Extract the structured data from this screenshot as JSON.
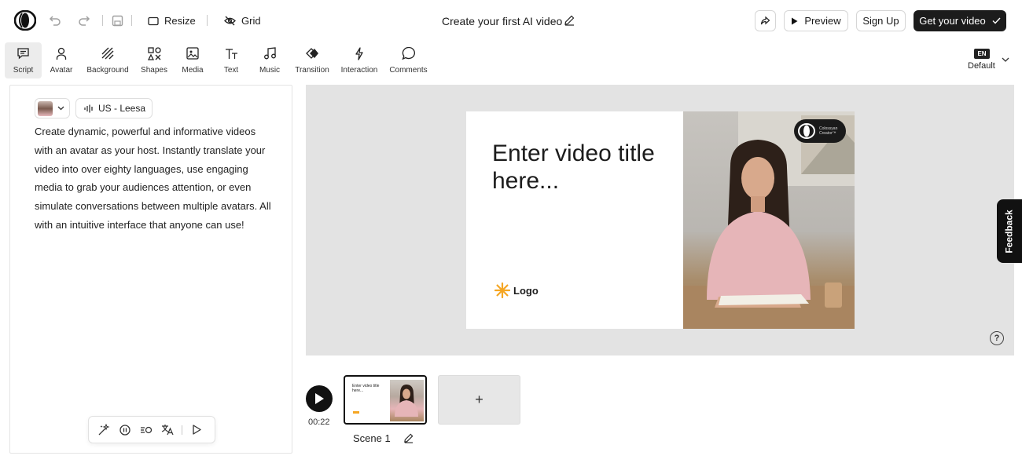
{
  "topbar": {
    "resize_label": "Resize",
    "grid_label": "Grid",
    "title": "Create your first AI video",
    "preview_label": "Preview",
    "signup_label": "Sign Up",
    "get_video_label": "Get your video"
  },
  "toolbar": {
    "items": [
      {
        "label": "Script",
        "icon": "script-icon"
      },
      {
        "label": "Avatar",
        "icon": "avatar-icon"
      },
      {
        "label": "Background",
        "icon": "background-icon"
      },
      {
        "label": "Shapes",
        "icon": "shapes-icon"
      },
      {
        "label": "Media",
        "icon": "media-icon"
      },
      {
        "label": "Text",
        "icon": "text-icon"
      },
      {
        "label": "Music",
        "icon": "music-icon"
      },
      {
        "label": "Transition",
        "icon": "transition-icon"
      },
      {
        "label": "Interaction",
        "icon": "interaction-icon"
      },
      {
        "label": "Comments",
        "icon": "comments-icon"
      }
    ],
    "active": "Script",
    "language_badge": "EN",
    "language_label": "Default"
  },
  "script_panel": {
    "voice_label": "US - Leesa",
    "text": "Create dynamic, powerful and informative videos with an avatar as your host. Instantly translate your video into over eighty languages, use engaging media to grab your audiences attention, or even simulate conversations between multiple avatars. All with an intuitive interface that anyone can use!"
  },
  "slide": {
    "title": "Enter video title here...",
    "logo_label": "Logo",
    "brand_line1": "Colossyan",
    "brand_line2": "Creator™"
  },
  "feedback_label": "Feedback",
  "help_label": "?",
  "timeline": {
    "duration": "00:22",
    "scene_label": "Scene 1",
    "thumb_title": "Enter video title here...",
    "add_label": "+"
  },
  "colors": {
    "accent_dark": "#1c1c1c",
    "canvas_bg": "#e3e3e3",
    "logo_star": "#f5a623"
  }
}
